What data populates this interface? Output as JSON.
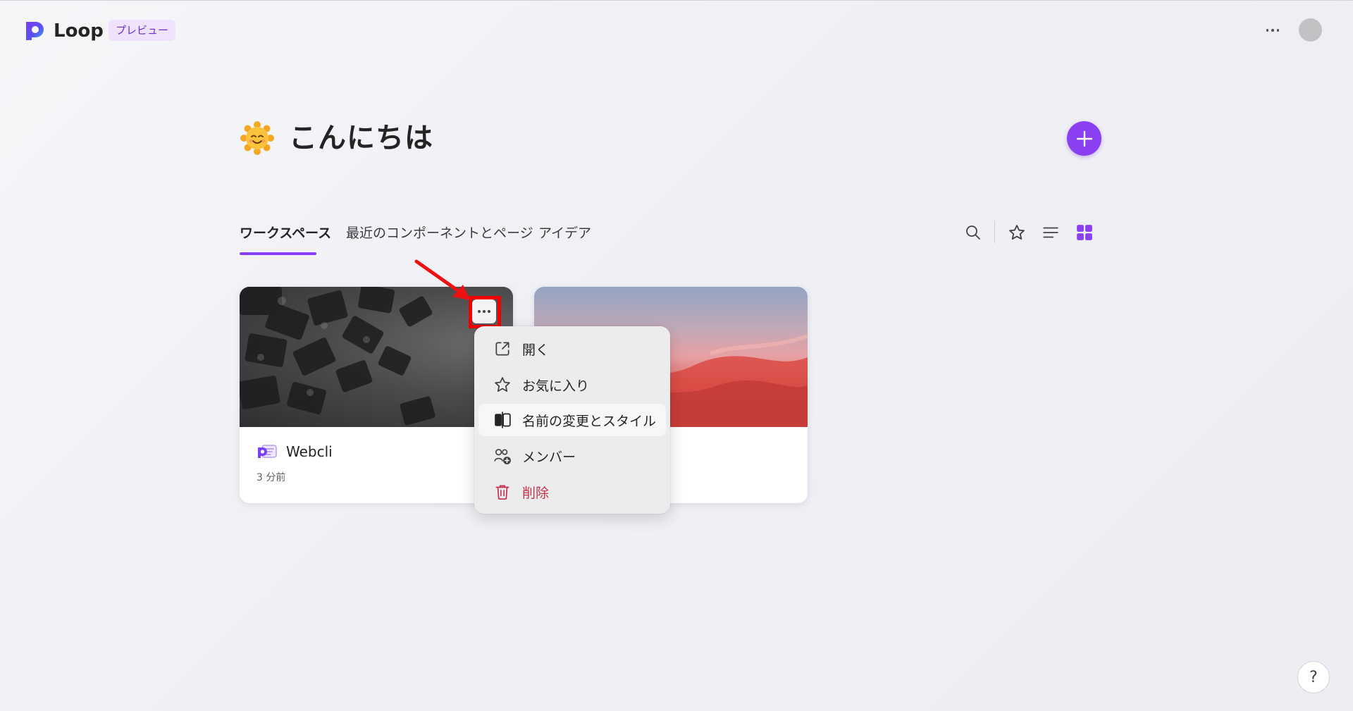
{
  "app": {
    "name": "Loop",
    "badge": "プレビュー"
  },
  "header": {
    "more_icon": "more-horizontal-icon",
    "avatar_icon": "avatar"
  },
  "greeting": {
    "emoji_icon": "smiling-sun-emoji",
    "text": "こんにちは"
  },
  "tabs": [
    {
      "label": "ワークスペース",
      "active": true
    },
    {
      "label": "最近のコンポーネントとページ",
      "active": false
    },
    {
      "label": "アイデア",
      "active": false
    }
  ],
  "toolbar": {
    "icons": [
      "search-icon",
      "star-icon",
      "list-view-icon",
      "grid-view-icon"
    ]
  },
  "cards": [
    {
      "title": "Webcli",
      "time": "3 分前",
      "icon": "loop-workspace-icon"
    },
    {
      "title": "",
      "time": "",
      "icon": ""
    }
  ],
  "context_menu": {
    "items": [
      {
        "label": "開く",
        "icon": "open-external-icon"
      },
      {
        "label": "お気に入り",
        "icon": "star-icon"
      },
      {
        "label": "名前の変更とスタイル",
        "icon": "rename-style-icon"
      },
      {
        "label": "メンバー",
        "icon": "add-person-icon"
      },
      {
        "label": "削除",
        "icon": "trash-icon"
      }
    ]
  },
  "help": {
    "label": "?"
  },
  "colors": {
    "accent": "#8a3ff0",
    "danger": "#c4314b",
    "annotation": "#f00000"
  }
}
